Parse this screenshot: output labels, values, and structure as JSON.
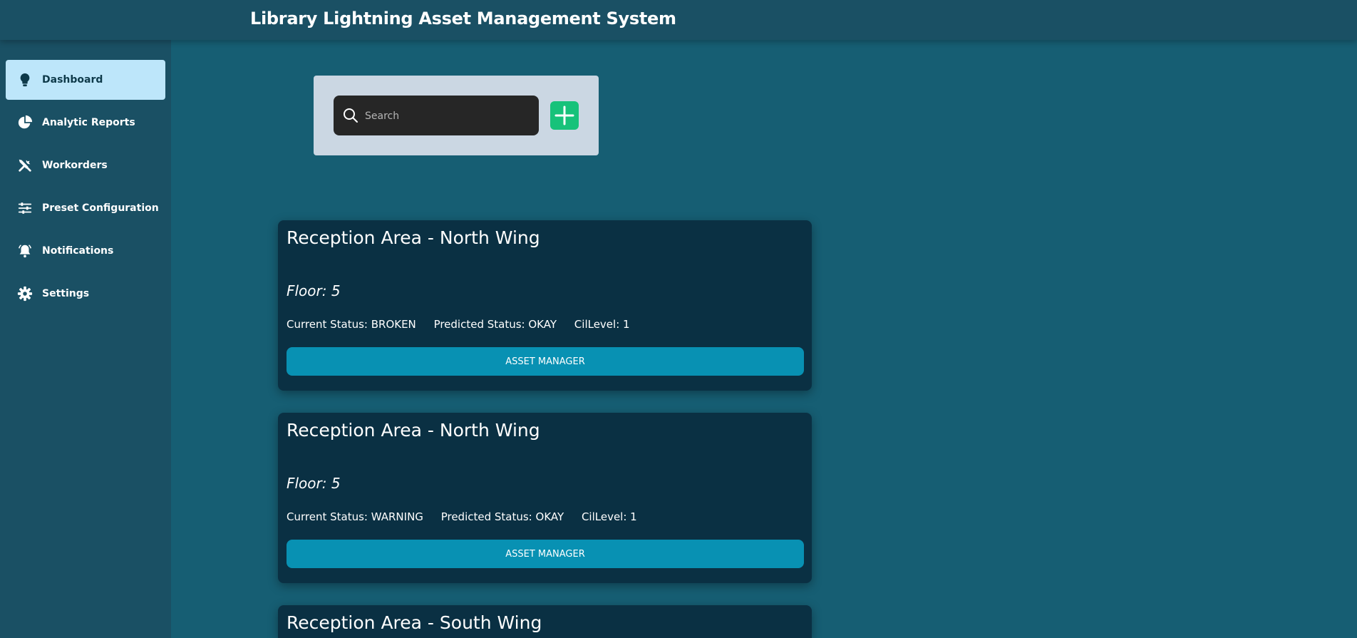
{
  "header": {
    "title": "Library Lightning Asset Management System"
  },
  "sidebar": {
    "items": [
      {
        "label": "Dashboard",
        "icon": "lightbulb-icon",
        "active": true
      },
      {
        "label": "Analytic Reports",
        "icon": "pie-chart-icon",
        "active": false
      },
      {
        "label": "Workorders",
        "icon": "tools-icon",
        "active": false
      },
      {
        "label": "Preset Configuration",
        "icon": "sliders-icon",
        "active": false
      },
      {
        "label": "Notifications",
        "icon": "bell-icon",
        "active": false
      },
      {
        "label": "Settings",
        "icon": "gear-icon",
        "active": false
      }
    ]
  },
  "search": {
    "placeholder": "Search",
    "value": ""
  },
  "colors": {
    "background": "#165e73",
    "topbar": "#1a5064",
    "sidebar": "#1a5064",
    "active_nav": "#bde6fa",
    "card": "#0a3043",
    "button": "#0891b3",
    "add_button": "#17c27a",
    "search_panel": "#cbd7e3"
  },
  "cards": [
    {
      "title": "Reception Area - North Wing",
      "floor": "Floor: 5",
      "current_status": "Current Status: BROKEN",
      "predicted_status": "Predicted Status: OKAY",
      "cil_level": "CilLevel: 1",
      "button_label": "ASSET MANAGER"
    },
    {
      "title": "Reception Area - North Wing",
      "floor": "Floor: 5",
      "current_status": "Current Status: WARNING",
      "predicted_status": "Predicted Status: OKAY",
      "cil_level": "CilLevel: 1",
      "button_label": "ASSET MANAGER"
    },
    {
      "title": "Reception Area - South Wing"
    }
  ]
}
